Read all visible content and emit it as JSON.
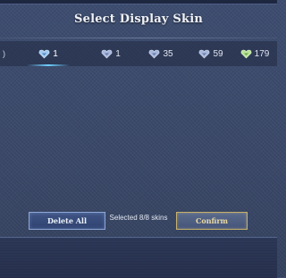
{
  "title": "Select Display Skin",
  "tabs": [
    {
      "label": "1",
      "active": true
    },
    {
      "label": "1",
      "active": false
    },
    {
      "label": "35",
      "active": false
    },
    {
      "label": "59",
      "active": false
    },
    {
      "label": "179",
      "active": false
    }
  ],
  "status_text": "Selected 8/8 skins",
  "buttons": {
    "delete_label": "Delete All",
    "confirm_label": "Confirm"
  },
  "icons": {
    "tab_icon": "heart-shield-icon"
  },
  "colors": {
    "background": "#3b4a6b",
    "accent_underline": "#6fd0ff",
    "confirm_border": "#c6b06a"
  }
}
